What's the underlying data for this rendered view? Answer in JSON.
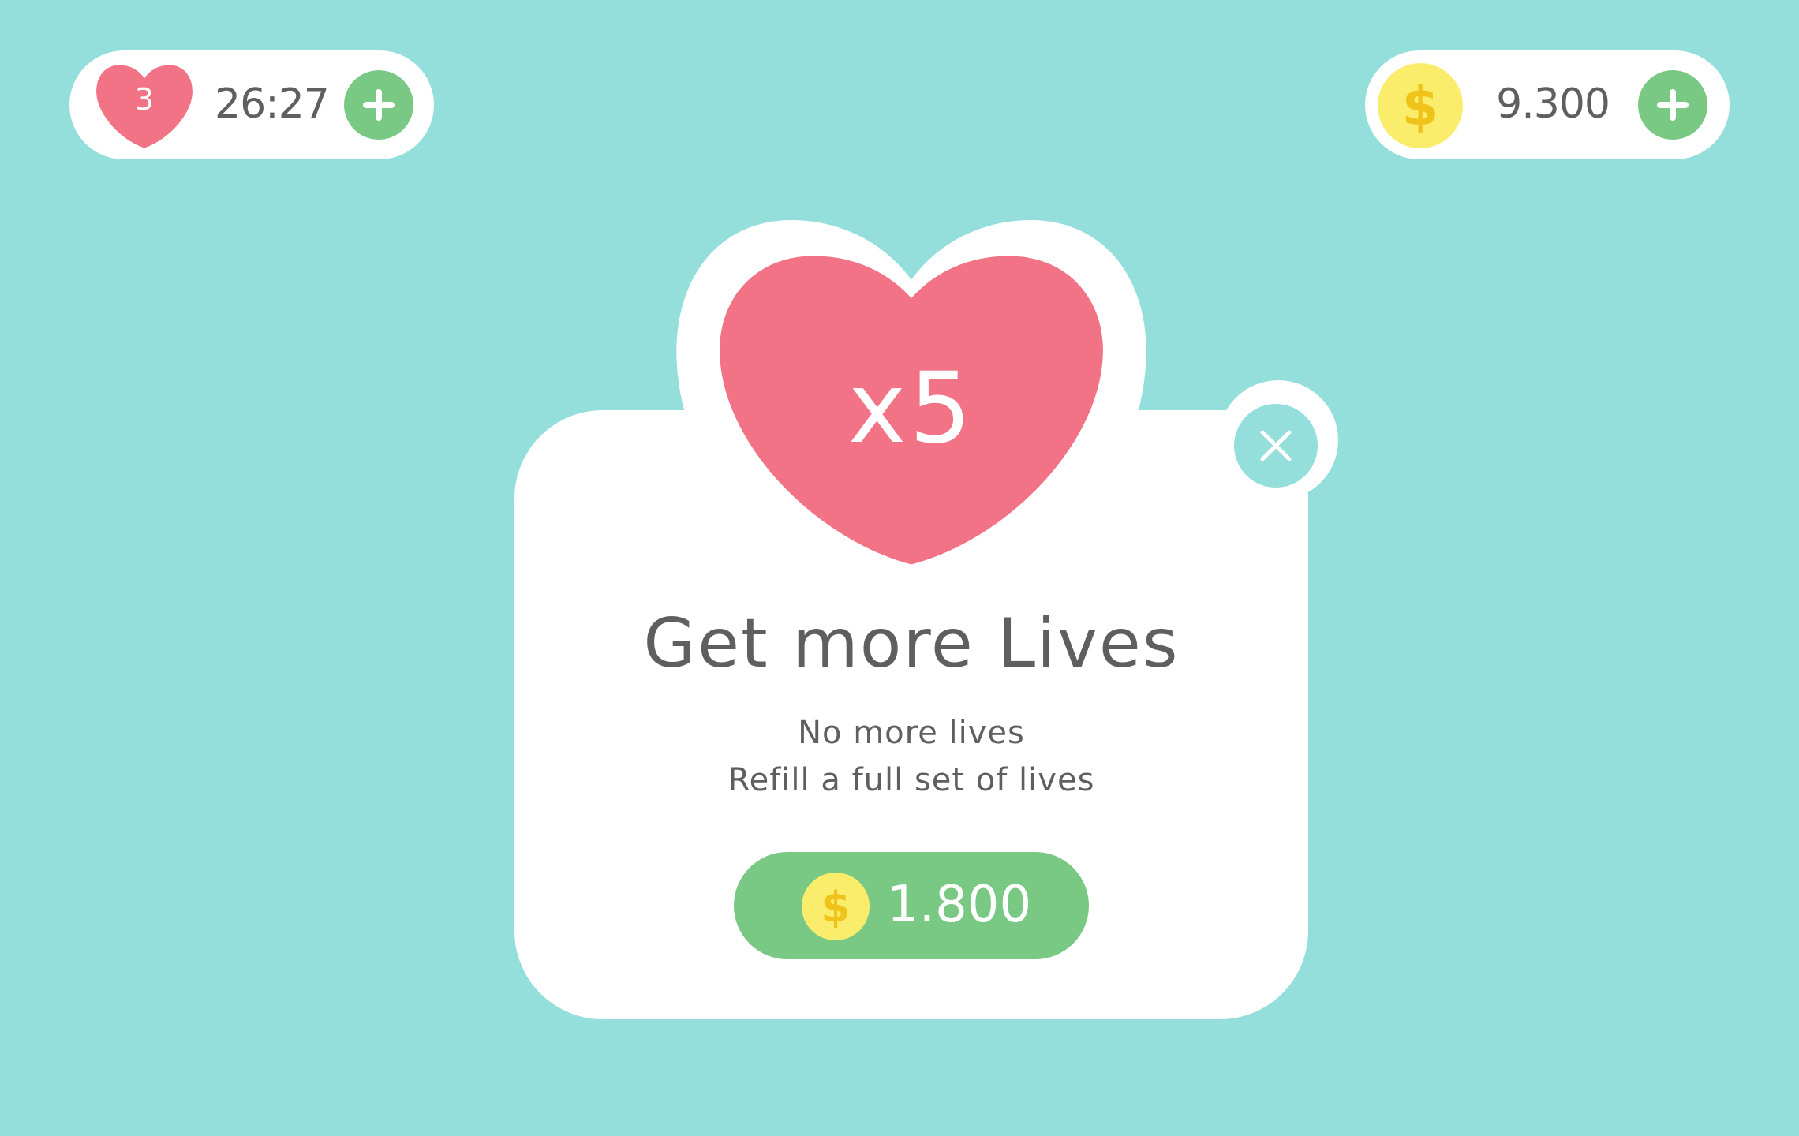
{
  "hud": {
    "lives": {
      "count": "3",
      "timer": "26:27",
      "heart_icon": "heart-icon",
      "add_icon": "plus-icon"
    },
    "coins": {
      "value": "9.300",
      "coin_icon": "dollar-coin-icon",
      "add_icon": "plus-icon"
    }
  },
  "modal": {
    "heart_multiplier": "x5",
    "title": "Get more Lives",
    "subtitle_line1": "No more lives",
    "subtitle_line2": "Refill a full set of lives",
    "buy_price": "1.800",
    "close_icon": "close-icon"
  },
  "colors": {
    "background": "#94dedb",
    "heart": "#f17385",
    "green": "#79c984",
    "coin": "#fbed6c",
    "coin_symbol": "#f0c31a",
    "text": "#5f5f5f"
  }
}
